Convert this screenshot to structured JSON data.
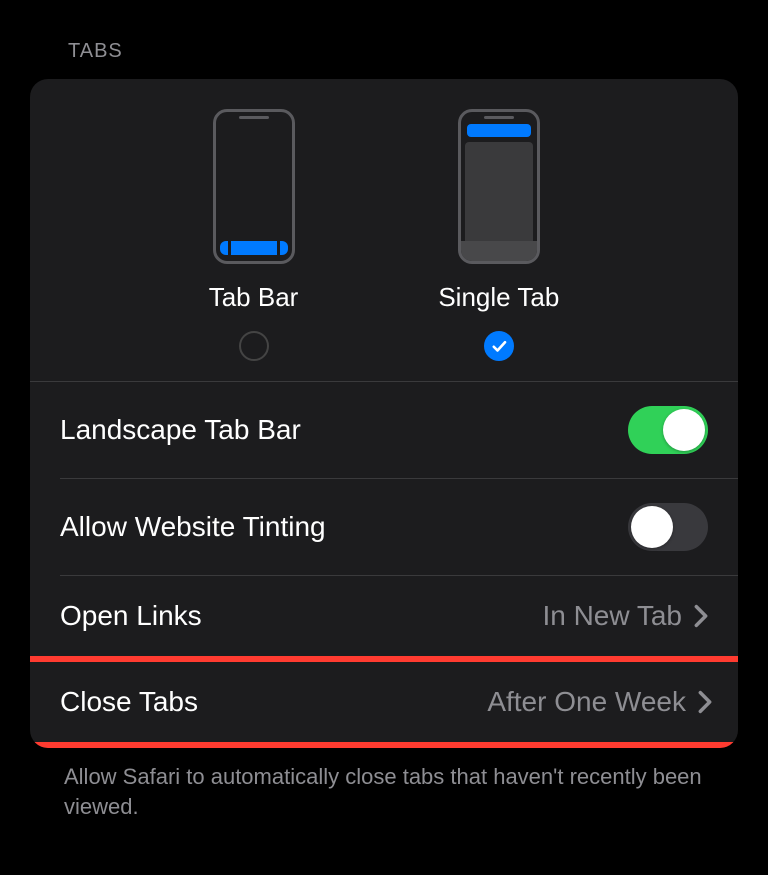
{
  "section_title": "TABS",
  "tab_layout": {
    "options": [
      {
        "label": "Tab Bar",
        "selected": false
      },
      {
        "label": "Single Tab",
        "selected": true
      }
    ]
  },
  "rows": {
    "landscape_tab_bar": {
      "label": "Landscape Tab Bar",
      "enabled": true
    },
    "allow_website_tinting": {
      "label": "Allow Website Tinting",
      "enabled": false
    },
    "open_links": {
      "label": "Open Links",
      "value": "In New Tab"
    },
    "close_tabs": {
      "label": "Close Tabs",
      "value": "After One Week"
    }
  },
  "footer": "Allow Safari to automatically close tabs that haven't recently been viewed."
}
